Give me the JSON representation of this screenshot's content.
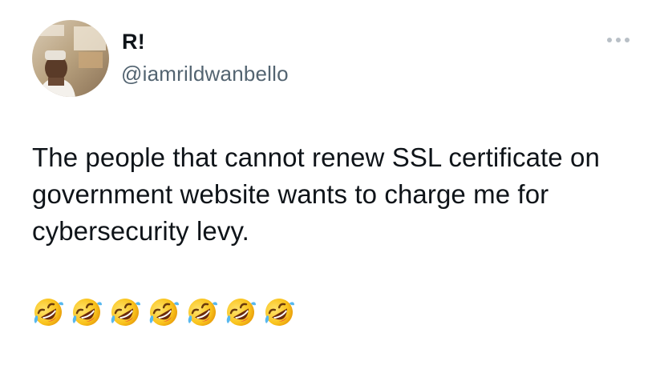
{
  "user": {
    "display_name": "R!",
    "handle": "@iamrildwanbello"
  },
  "tweet": {
    "text": "The people that cannot renew SSL certificate on government website wants to charge me for cybersecurity levy.",
    "emojis": [
      "rolling-on-floor-laughing",
      "rolling-on-floor-laughing",
      "rolling-on-floor-laughing",
      "rolling-on-floor-laughing",
      "rolling-on-floor-laughing",
      "rolling-on-floor-laughing",
      "rolling-on-floor-laughing"
    ]
  },
  "icons": {
    "more": "more-horizontal-icon",
    "emoji": "rolling-on-floor-laughing-emoji"
  },
  "colors": {
    "text_primary": "#0f1419",
    "text_secondary": "#536471",
    "icon_gray": "#b8bfc6",
    "background": "#ffffff"
  }
}
